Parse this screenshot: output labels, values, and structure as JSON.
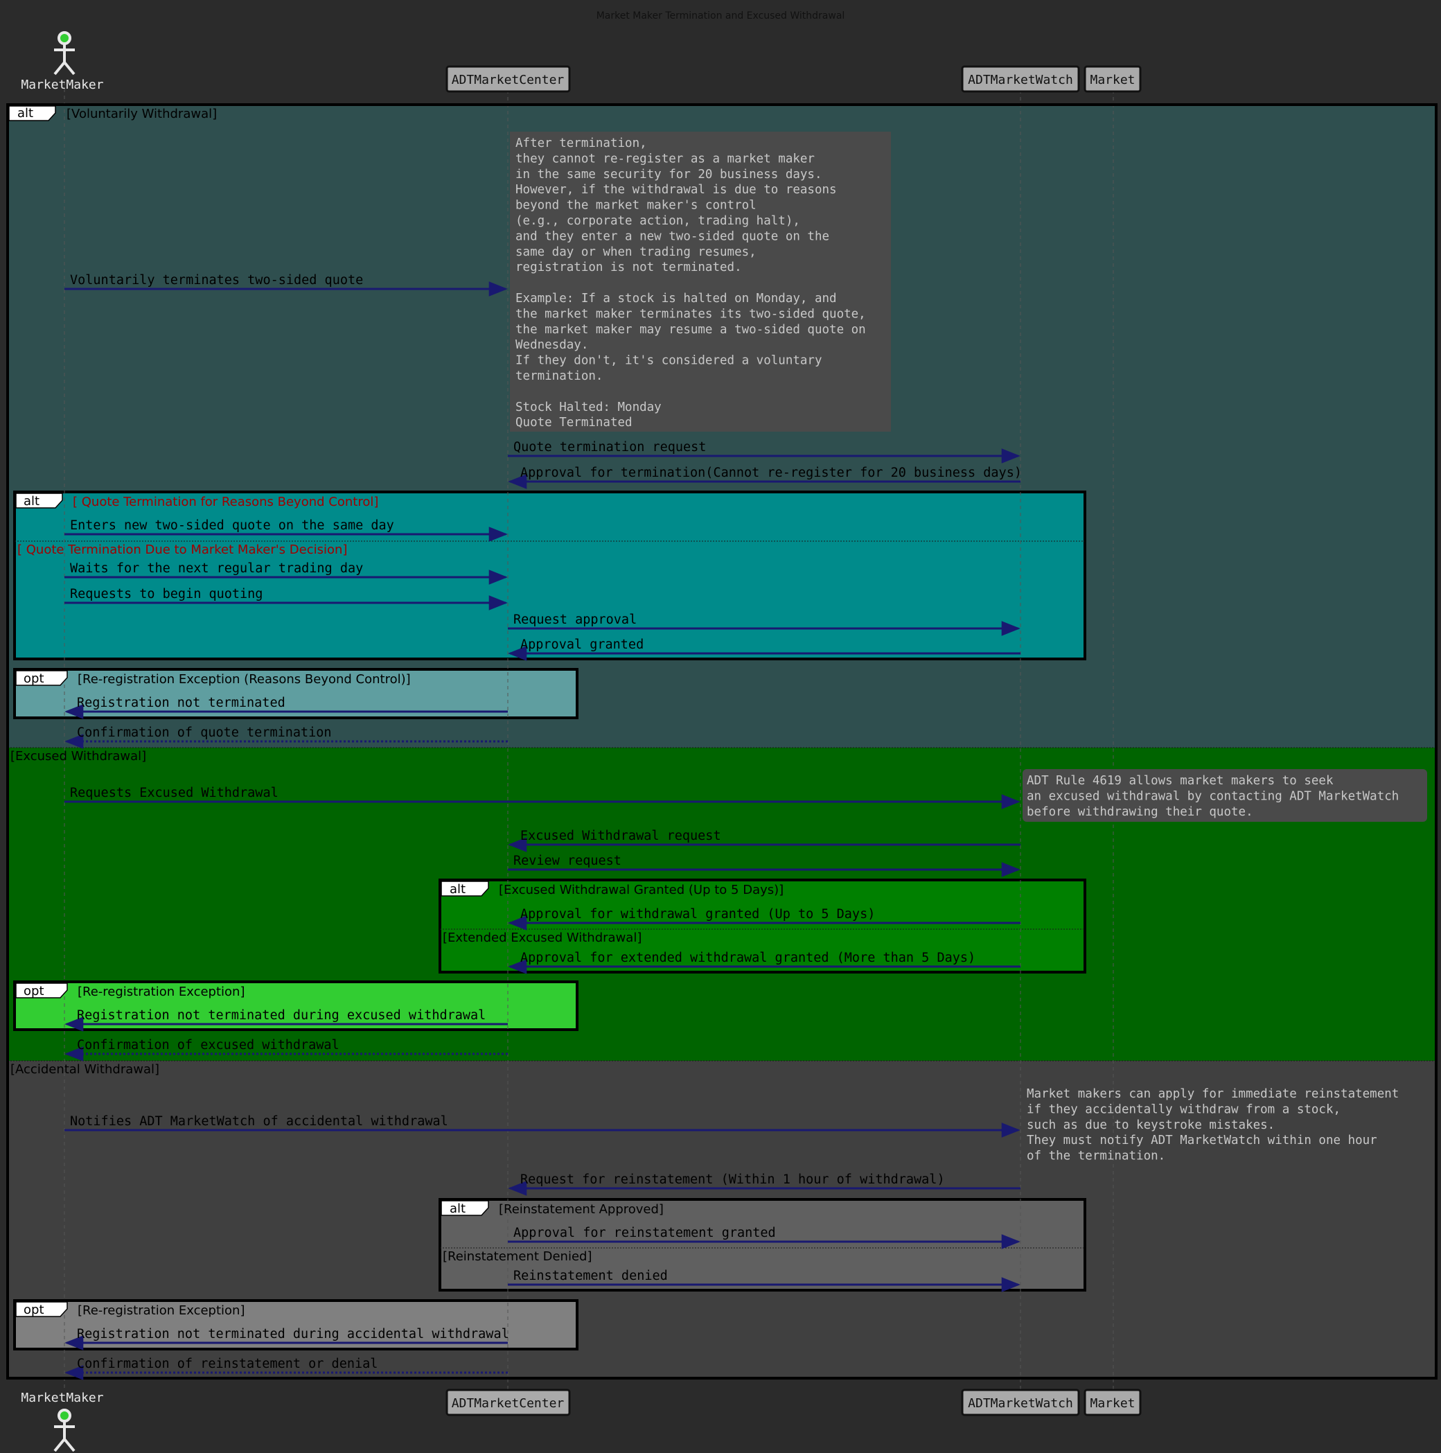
{
  "title": "Market Maker Termination and Excused Withdrawal",
  "participants": {
    "market_maker": "MarketMaker",
    "center": "ADTMarketCenter",
    "watch": "ADTMarketWatch",
    "market": "Market"
  },
  "colors": {
    "background": "#2b2b2b",
    "voluntary_bg": "#2f4f4f",
    "inner_alt_bg": "#008b8b",
    "opt1_bg": "#5f9ea0",
    "excused_bg": "#006400",
    "excused_alt_bg": "#008000",
    "opt2_bg": "#32cd32",
    "accidental_bg": "#404040",
    "accidental_alt_bg": "#606060",
    "opt3_bg": "#808080",
    "arrow": "#191970",
    "note_bg": "#4a4a4a",
    "condition_red": "#a00000",
    "actor_head": "#32cd32"
  },
  "main_alt": {
    "keyword": "alt",
    "voluntary_guard": "[Voluntarily Withdrawal]",
    "excused_guard": "[Excused Withdrawal]",
    "accidental_guard": "[Accidental Withdrawal]"
  },
  "notes": {
    "termination": [
      "After termination,",
      "they cannot re-register as a market maker",
      "in the same security for 20 business days.",
      "However, if the withdrawal is due to reasons",
      "beyond the market maker's control",
      "(e.g., corporate action, trading halt),",
      "and they enter a new two-sided quote on the",
      "same day or when trading resumes,",
      "registration is not terminated.",
      "",
      "Example: If a stock is halted on Monday, and",
      "the market maker terminates its two-sided quote,",
      "the market maker may resume a two-sided quote on",
      "Wednesday.",
      "If they don't, it's considered a voluntary",
      "termination.",
      "",
      "Stock Halted: Monday",
      "Quote Terminated"
    ],
    "excused": [
      "ADT Rule 4619 allows market makers to seek",
      "an excused withdrawal by contacting ADT MarketWatch",
      "before withdrawing their quote."
    ],
    "accidental": [
      "Market makers can apply for immediate reinstatement",
      "if they accidentally withdraw from a stock,",
      "such as due to keystroke mistakes.",
      "They must notify ADT MarketWatch within one hour",
      "of the termination."
    ]
  },
  "messages": {
    "m1": "Voluntarily terminates two-sided quote",
    "m2": "Quote termination request",
    "m3": "Approval for termination(Cannot re-register for 20 business days)",
    "m4": "Enters new two-sided quote on the same day",
    "m5": "Waits for the next regular trading day",
    "m6": "Requests to begin quoting",
    "m7": "Request approval",
    "m8": "Approval granted",
    "m9": "Registration not terminated",
    "m10": "Confirmation of quote termination",
    "m11": "Requests Excused Withdrawal",
    "m12": "Excused Withdrawal request",
    "m13": "Review request",
    "m14": "Approval for withdrawal granted (Up to 5 Days)",
    "m15": "Approval for extended withdrawal granted (More than 5 Days)",
    "m16": "Registration not terminated during excused withdrawal",
    "m17": "Confirmation of excused withdrawal",
    "m18": "Notifies ADT MarketWatch of accidental withdrawal",
    "m19": "Request for reinstatement (Within 1 hour of withdrawal)",
    "m20": "Approval for reinstatement granted",
    "m21": "Reinstatement denied",
    "m22": "Registration not terminated during accidental withdrawal",
    "m23": "Confirmation of reinstatement or denial"
  },
  "fragments": {
    "alt_keyword": "alt",
    "opt_keyword": "opt",
    "beyond_control_guard": "[ Quote Termination for Reasons Beyond Control]",
    "decision_guard": "[ Quote Termination Due to Market Maker's Decision]",
    "reregistration_beyond_guard": "[Re-registration Exception (Reasons Beyond Control)]",
    "excused_granted_guard": "[Excused Withdrawal Granted (Up to 5 Days)]",
    "extended_guard": "[Extended Excused Withdrawal]",
    "reregistration_guard": "[Re-registration Exception]",
    "reinstatement_approved_guard": "[Reinstatement Approved]",
    "reinstatement_denied_guard": "[Reinstatement Denied]"
  }
}
